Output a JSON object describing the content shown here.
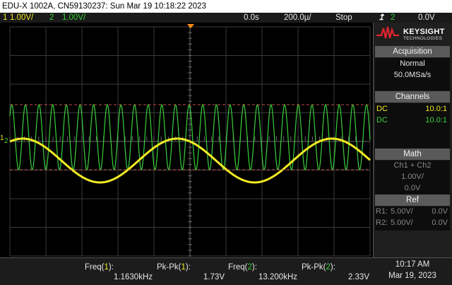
{
  "title": "EDU-X 1002A, CN59130237: Sun Mar 19 10:18:22 2023",
  "status": {
    "ch1_num": "1",
    "ch1_scale": "1.00V/",
    "ch2_num": "2",
    "ch2_scale": "1.00V/",
    "time_offset": "0.0s",
    "timebase": "200.0µ/",
    "run_state": "Stop",
    "trigger_icon": "trigger-edge-icon",
    "trigger_source": "2",
    "trigger_level": "0.0V"
  },
  "brand": {
    "name": "KEYSIGHT",
    "sub": "TECHNOLOGIES"
  },
  "acquisition": {
    "header": "Acquisition",
    "mode": "Normal",
    "rate": "50.0MSa/s"
  },
  "channels": {
    "header": "Channels",
    "rows": [
      {
        "coupling": "DC",
        "probe": "10.0:1"
      },
      {
        "coupling": "DC",
        "probe": "10.0:1"
      }
    ]
  },
  "math": {
    "header": "Math",
    "func": "Ch1 + Ch2",
    "scale": "1.00V/",
    "offset": "0.0V"
  },
  "ref": {
    "header": "Ref",
    "rows": [
      {
        "label": "R1:",
        "scale": "5.00V/",
        "offset": "0.0V"
      },
      {
        "label": "R2:",
        "scale": "5.00V/",
        "offset": "0.0V"
      }
    ]
  },
  "measurements": [
    {
      "name": "Freq",
      "ch": "1",
      "value": "1.1630kHz"
    },
    {
      "name": "Pk-Pk",
      "ch": "1",
      "value": "1.73V"
    },
    {
      "name": "Freq",
      "ch": "2",
      "value": "13.200kHz"
    },
    {
      "name": "Pk-Pk",
      "ch": "2",
      "value": "2.33V"
    }
  ],
  "clock": {
    "time": "10:17 AM",
    "date": "Mar 19, 2023"
  },
  "markers": {
    "ch1_marker": "1",
    "ch2_marker": "2"
  },
  "colors": {
    "ch1": "#f2ea24",
    "ch2": "#3ad13a",
    "trigger": "#ff8c1a",
    "cursor": "#c0504d"
  }
}
